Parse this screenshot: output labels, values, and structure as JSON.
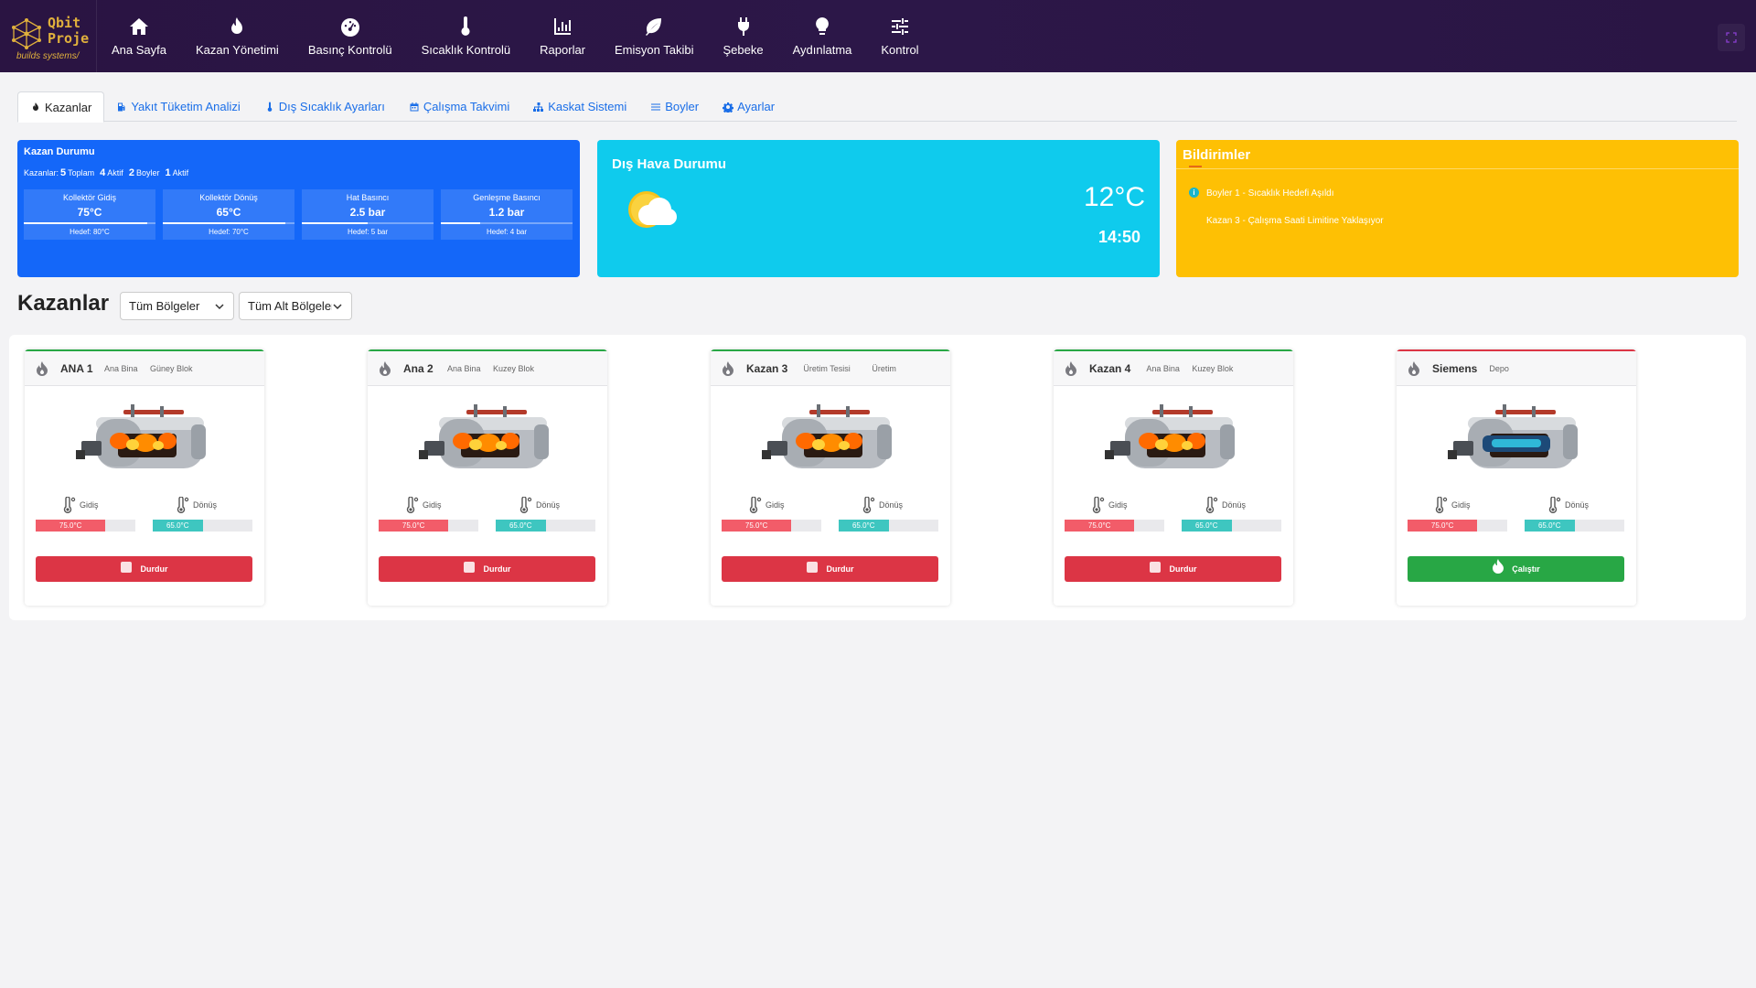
{
  "app": {
    "logo_line1": "Qbit",
    "logo_line2": "Proje",
    "logo_tagline": "builds systems/",
    "accent_color": "#2a1544"
  },
  "nav": [
    {
      "label": "Ana Sayfa",
      "icon": "home-icon"
    },
    {
      "label": "Kazan Yönetimi",
      "icon": "flame-icon"
    },
    {
      "label": "Basınç Kontrolü",
      "icon": "gauge-icon"
    },
    {
      "label": "Sıcaklık Kontrolü",
      "icon": "thermometer-icon"
    },
    {
      "label": "Raporlar",
      "icon": "chart-icon"
    },
    {
      "label": "Emisyon Takibi",
      "icon": "leaf-icon"
    },
    {
      "label": "Şebeke",
      "icon": "plug-icon"
    },
    {
      "label": "Aydınlatma",
      "icon": "lightbulb-icon"
    },
    {
      "label": "Kontrol",
      "icon": "sliders-icon"
    }
  ],
  "tabs": [
    {
      "label": "Kazanlar",
      "icon": "fire-icon",
      "active": true
    },
    {
      "label": "Yakıt Tüketim Analizi",
      "icon": "fuel-icon"
    },
    {
      "label": "Dış Sıcaklık Ayarları",
      "icon": "thermometer-icon"
    },
    {
      "label": "Çalışma Takvimi",
      "icon": "calendar-icon"
    },
    {
      "label": "Kaskat Sistemi",
      "icon": "sitemap-icon"
    },
    {
      "label": "Boyler",
      "icon": "bars-icon"
    },
    {
      "label": "Ayarlar",
      "icon": "cog-icon"
    }
  ],
  "kazan_durumu": {
    "title": "Kazan Durumu",
    "kazanlar_label": "Kazanlar:",
    "total_count": "5",
    "total_label": "Toplam",
    "active_count": "4",
    "active_label": "Aktif",
    "boyler_count": "2",
    "boyler_label": "Boyler",
    "boyler_active_count": "1",
    "boyler_active_label": "Aktif",
    "metrics": [
      {
        "label": "Kollektör Gidiş",
        "value": "75°C",
        "target": "Hedef: 80°C",
        "progress": 0.94
      },
      {
        "label": "Kollektör Dönüş",
        "value": "65°C",
        "target": "Hedef: 70°C",
        "progress": 0.93
      },
      {
        "label": "Hat Basıncı",
        "value": "2.5 bar",
        "target": "Hedef: 5 bar",
        "progress": 0.5
      },
      {
        "label": "Genleşme Basıncı",
        "value": "1.2 bar",
        "target": "Hedef: 4 bar",
        "progress": 0.3
      }
    ]
  },
  "weather": {
    "title": "Dış Hava Durumu",
    "temperature": "12°C",
    "time": "14:50",
    "icon": "partly-sunny-icon"
  },
  "notifications": {
    "title": "Bildirimler",
    "items": [
      "Boyler 1 - Sıcaklık Hedefi Aşıldı",
      "Kazan 3 - Çalışma Saati Limitine Yaklaşıyor"
    ]
  },
  "section": {
    "title": "Kazanlar",
    "region_select": "Tüm Bölgeler",
    "subregion_select": "Tüm Alt Bölgeler"
  },
  "boilers": [
    {
      "name": "ANA 1",
      "loc1": "Ana Bina",
      "loc2": "Güney Blok",
      "status_color": "#28a745",
      "gidis_label": "Gidiş",
      "donus_label": "Dönüş",
      "gidis": "75.0°C",
      "donus": "65.0°C",
      "gidis_pct": 0.7,
      "donus_pct": 0.5,
      "button": "Durdur",
      "running": true
    },
    {
      "name": "Ana 2",
      "loc1": "Ana Bina",
      "loc2": "Kuzey Blok",
      "status_color": "#28a745",
      "gidis_label": "Gidiş",
      "donus_label": "Dönüş",
      "gidis": "75.0°C",
      "donus": "65.0°C",
      "gidis_pct": 0.7,
      "donus_pct": 0.5,
      "button": "Durdur",
      "running": true
    },
    {
      "name": "Kazan 3",
      "loc1": "Üretim Tesisi",
      "loc2": "Üretim",
      "status_color": "#28a745",
      "gidis_label": "Gidiş",
      "donus_label": "Dönüş",
      "gidis": "75.0°C",
      "donus": "65.0°C",
      "gidis_pct": 0.7,
      "donus_pct": 0.5,
      "button": "Durdur",
      "running": true
    },
    {
      "name": "Kazan 4",
      "loc1": "Ana Bina",
      "loc2": "Kuzey Blok",
      "status_color": "#28a745",
      "gidis_label": "Gidiş",
      "donus_label": "Dönüş",
      "gidis": "75.0°C",
      "donus": "65.0°C",
      "gidis_pct": 0.7,
      "donus_pct": 0.5,
      "button": "Durdur",
      "running": true
    },
    {
      "name": "Siemens",
      "loc1": "Depo",
      "loc2": "",
      "status_color": "#dc3545",
      "gidis_label": "Gidiş",
      "donus_label": "Dönüş",
      "gidis": "75.0°C",
      "donus": "65.0°C",
      "gidis_pct": 0.7,
      "donus_pct": 0.5,
      "button": "Çalıştır",
      "running": false
    }
  ],
  "colors": {
    "stop_button": "#dc3545",
    "start_button": "#28a745",
    "gidis_bar": "#f25c69",
    "donus_bar": "#3ec6c0"
  }
}
